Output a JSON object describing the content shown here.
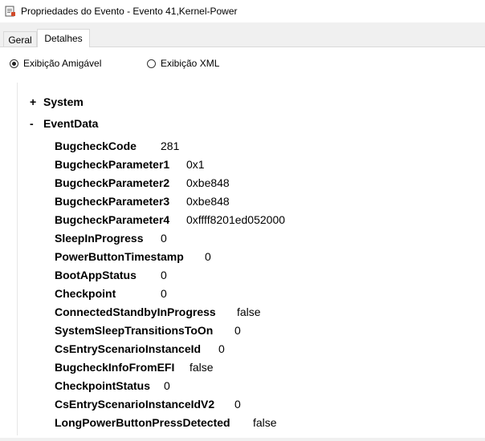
{
  "window": {
    "title": "Propriedades do Evento - Evento 41,Kernel-Power"
  },
  "tabs": [
    {
      "label": "Geral"
    },
    {
      "label": "Detalhes"
    }
  ],
  "view": {
    "friendly_label": "Exibição Amigável",
    "xml_label": "Exibição XML"
  },
  "tree": {
    "system": {
      "toggle": "+",
      "label": "System"
    },
    "eventdata": {
      "toggle": "-",
      "label": "EventData"
    }
  },
  "rows": [
    {
      "key": "BugcheckCode",
      "value": "281"
    },
    {
      "key": "BugcheckParameter1",
      "value": "0x1"
    },
    {
      "key": "BugcheckParameter2",
      "value": "0xbe848"
    },
    {
      "key": "BugcheckParameter3",
      "value": "0xbe848"
    },
    {
      "key": "BugcheckParameter4",
      "value": "0xffff8201ed052000"
    },
    {
      "key": "SleepInProgress",
      "value": "0"
    },
    {
      "key": "PowerButtonTimestamp",
      "value": "0"
    },
    {
      "key": "BootAppStatus",
      "value": "0"
    },
    {
      "key": "Checkpoint",
      "value": "0"
    },
    {
      "key": "ConnectedStandbyInProgress",
      "value": "false"
    },
    {
      "key": "SystemSleepTransitionsToOn",
      "value": "0"
    },
    {
      "key": "CsEntryScenarioInstanceId",
      "value": "0"
    },
    {
      "key": "BugcheckInfoFromEFI",
      "value": "false"
    },
    {
      "key": "CheckpointStatus",
      "value": "0"
    },
    {
      "key": "CsEntryScenarioInstanceIdV2",
      "value": "0"
    },
    {
      "key": "LongPowerButtonPressDetected",
      "value": "false"
    }
  ]
}
